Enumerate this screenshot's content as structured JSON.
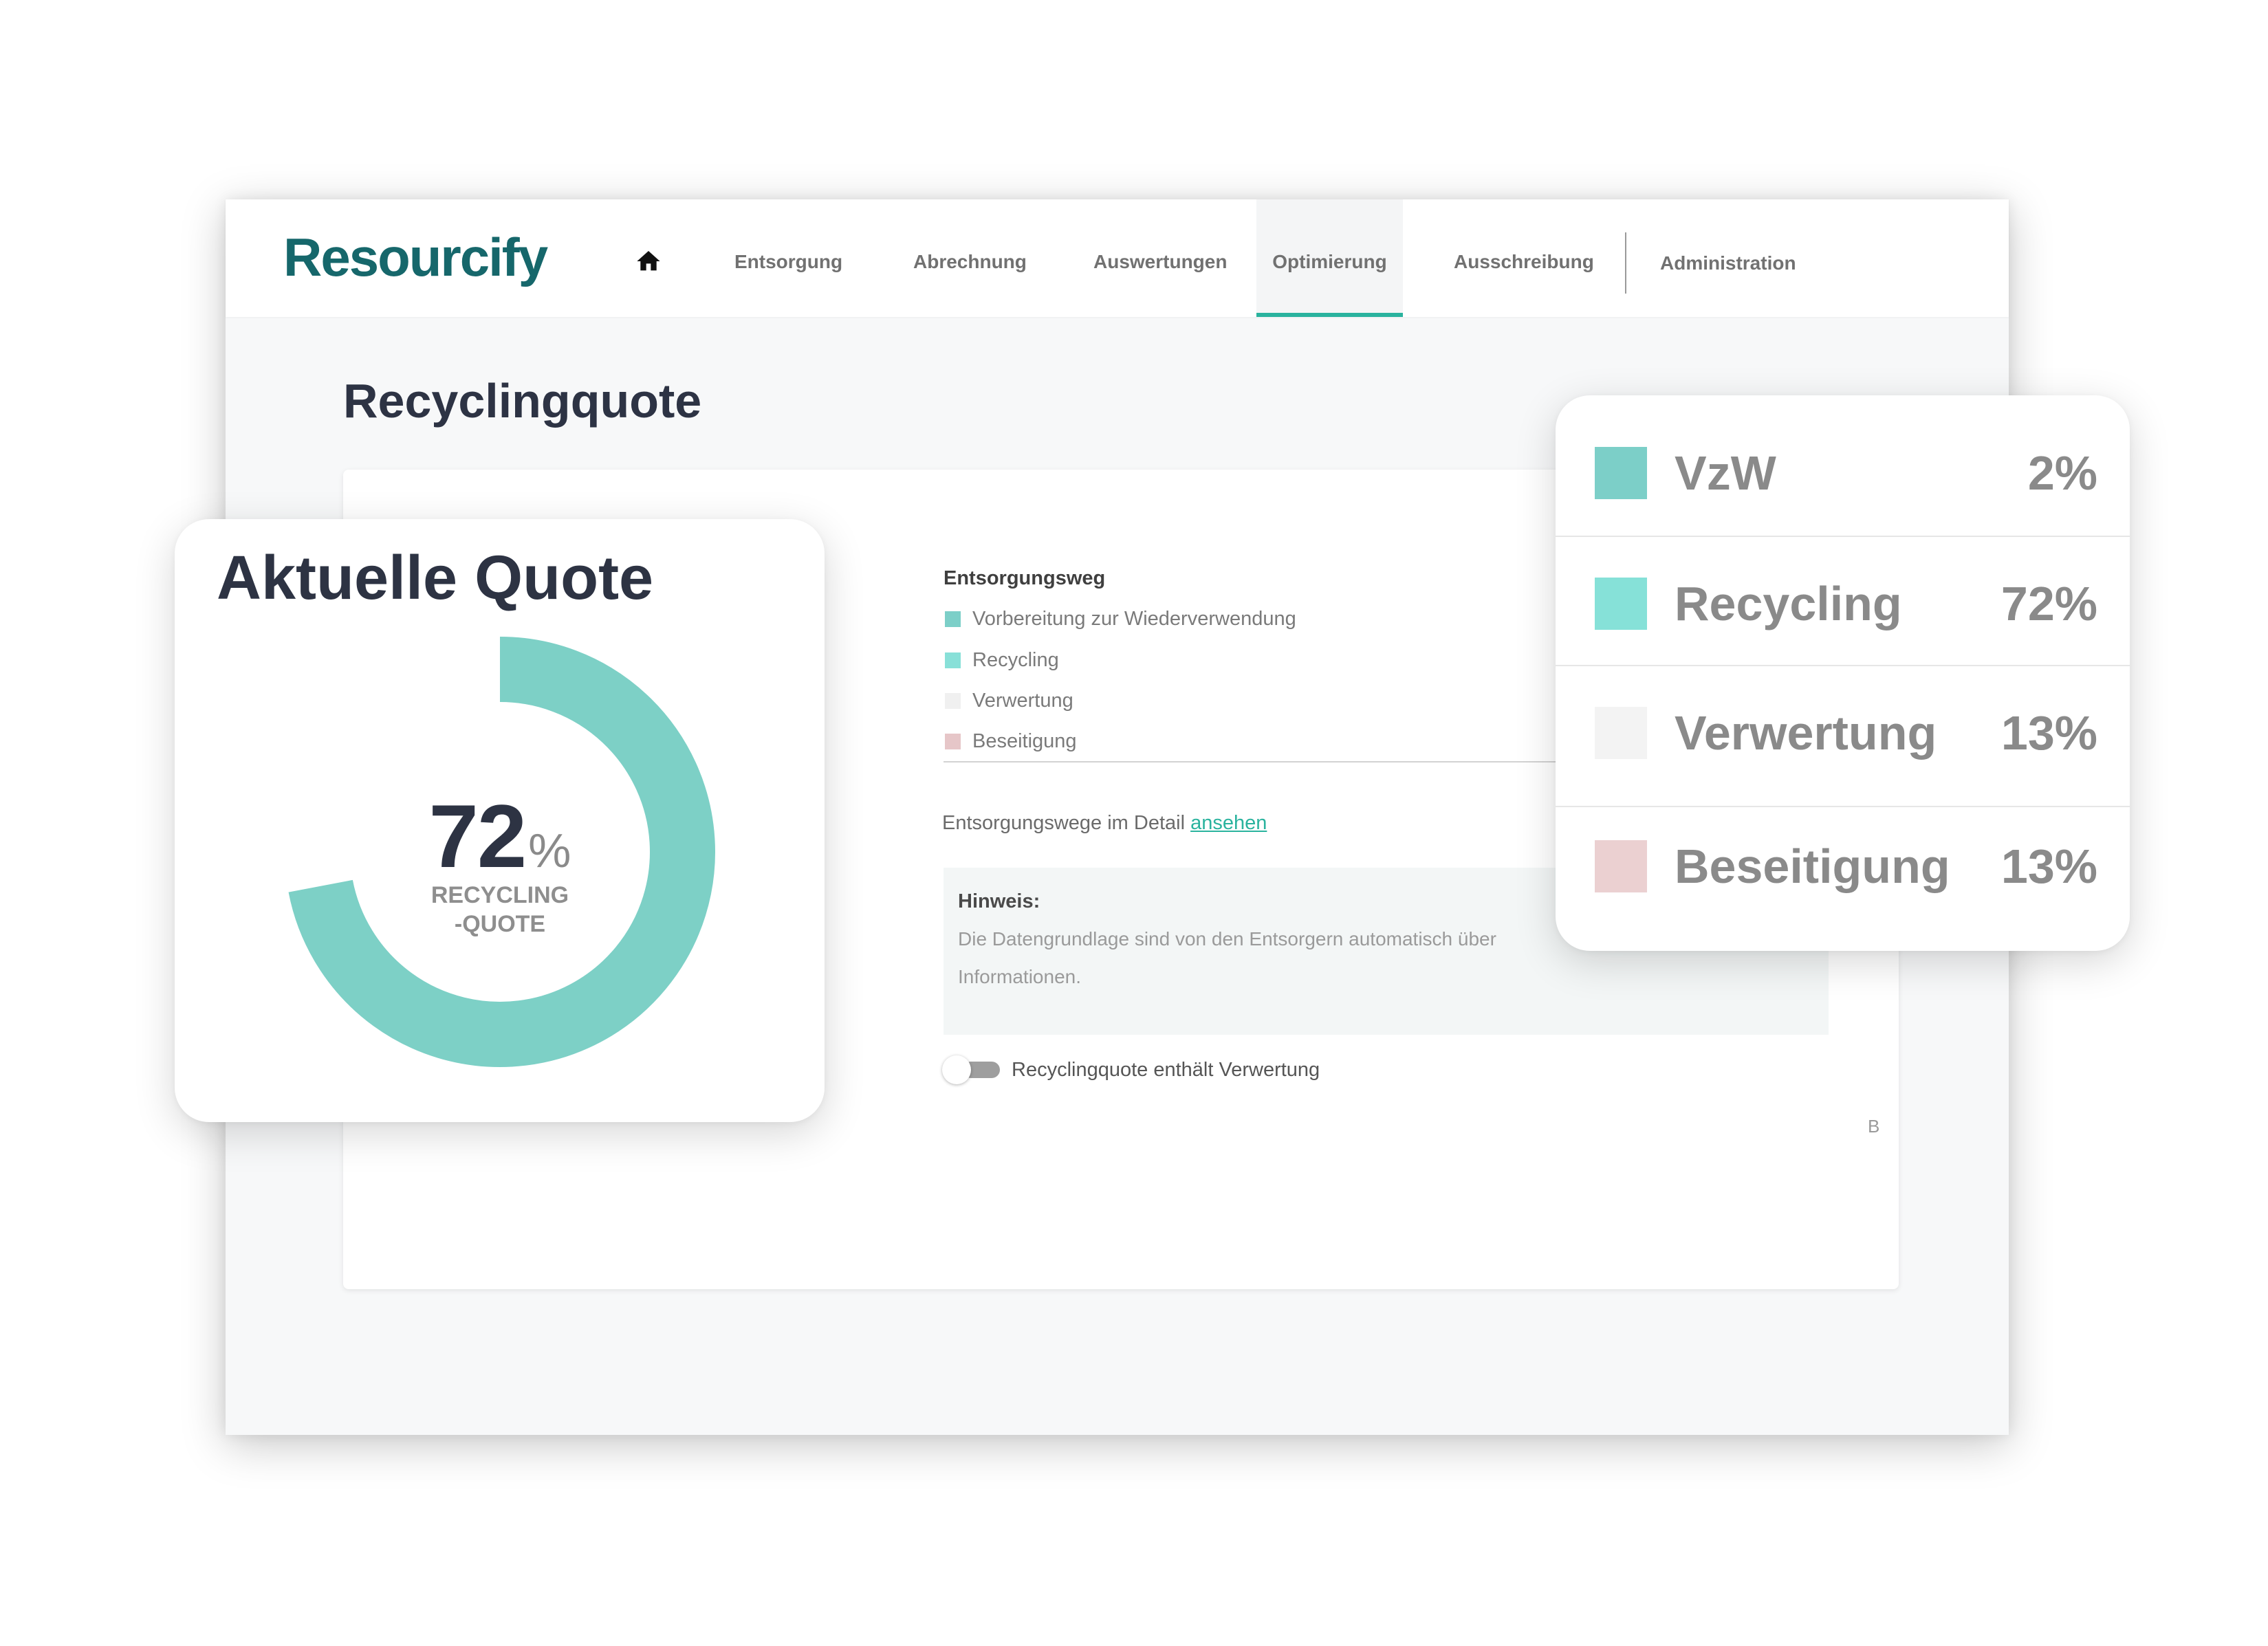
{
  "header": {
    "logo_text": "Resourcify",
    "logo_color": "#16676b",
    "accent_color": "#2ab39e",
    "home_icon": "home-icon",
    "nav": [
      {
        "label": "Entsorgung",
        "active": false
      },
      {
        "label": "Abrechnung",
        "active": false
      },
      {
        "label": "Auswertungen",
        "active": false
      },
      {
        "label": "Optimierung",
        "active": true
      },
      {
        "label": "Ausschreibung",
        "active": false
      },
      {
        "label": "Administration",
        "active": false
      }
    ]
  },
  "page": {
    "title": "Recyclingquote"
  },
  "main_card": {
    "legend_title": "Entsorgungsweg",
    "legend": [
      {
        "label": "Vorbereitung zur Wiederverwendung",
        "color": "#7ccfc8"
      },
      {
        "label": "Recycling",
        "color": "#88e0d8"
      },
      {
        "label": "Verwertung",
        "color": "#f0f0f0"
      },
      {
        "label": "Beseitigung",
        "color": "#e6c6c8"
      }
    ],
    "detail_text": "Entsorgungswege im Detail",
    "detail_link": "ansehen",
    "hint": {
      "title": "Hinweis:",
      "line1": "Die Datengrundlage sind von den Entsorgern automatisch über",
      "line2": "Informationen."
    },
    "toggle": {
      "label": "Recyclingquote enthält Verwertung",
      "on": false
    },
    "corner_label": "B"
  },
  "chart_data": {
    "type": "pie",
    "title": "Aktuelle Quote",
    "value": 72,
    "max": 100,
    "unit": "%",
    "center_caption": [
      "RECYCLING",
      "-QUOTE"
    ],
    "color": "#7dd0c6"
  },
  "breakdown": [
    {
      "label": "VzW",
      "value": "2%",
      "color": "#7ccfc8"
    },
    {
      "label": "Recycling",
      "value": "72%",
      "color": "#86e1d8"
    },
    {
      "label": "Verwertung",
      "value": "13%",
      "color": "#f3f3f3"
    },
    {
      "label": "Beseitigung",
      "value": "13%",
      "color": "#ebd0d1"
    }
  ]
}
